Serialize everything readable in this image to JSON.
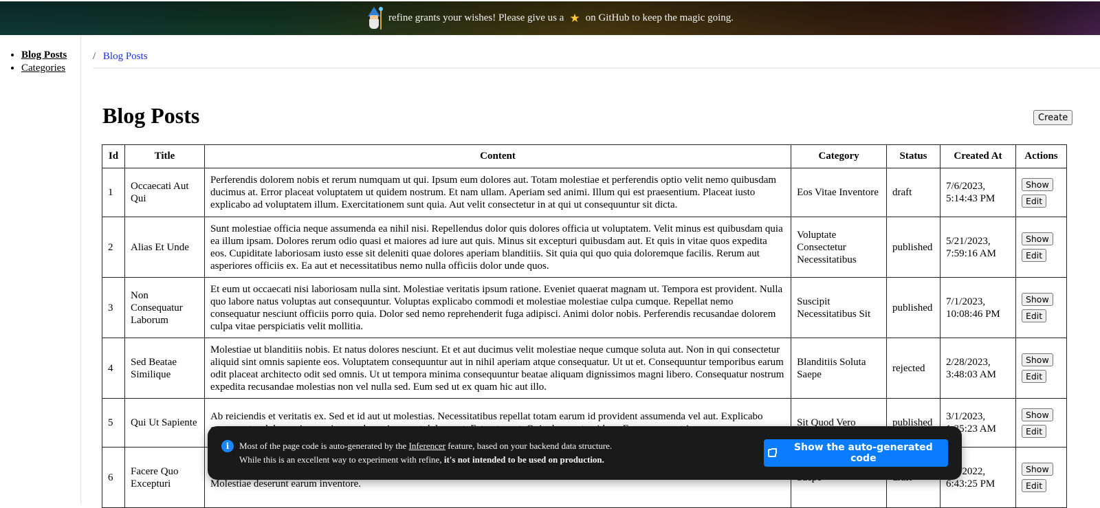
{
  "banner": {
    "text_before": "refine grants your wishes! Please give us a",
    "star": "★",
    "text_after": "on GitHub to keep the magic going."
  },
  "sidebar": {
    "items": [
      {
        "label": "Blog Posts",
        "active": true
      },
      {
        "label": "Categories",
        "active": false
      }
    ]
  },
  "breadcrumb": {
    "separator": "/",
    "items": [
      "Blog Posts"
    ]
  },
  "page": {
    "title": "Blog Posts",
    "create_label": "Create"
  },
  "table": {
    "headers": [
      "Id",
      "Title",
      "Content",
      "Category",
      "Status",
      "Created At",
      "Actions"
    ],
    "rows": [
      {
        "id": "1",
        "title": "Occaecati Aut Qui",
        "content": "Perferendis dolorem nobis et rerum numquam ut qui. Ipsum eum dolores aut. Totam molestiae et perferendis optio velit nemo quibusdam ducimus at. Error placeat voluptatem ut quidem nostrum. Et nam ullam. Aperiam sed animi. Illum qui est praesentium. Placeat iusto explicabo ad voluptatem illum. Exercitationem sunt quia. Aut velit consectetur in at qui ut consequuntur sit dicta.",
        "category": "Eos Vitae Inventore",
        "status": "draft",
        "created_at": "7/6/2023, 5:14:43 PM",
        "show_label": "Show",
        "edit_label": "Edit"
      },
      {
        "id": "2",
        "title": "Alias Et Unde",
        "content": "Sunt molestiae officia neque assumenda ea nihil nisi. Repellendus dolor quis dolores officia ut voluptatem. Velit minus est quibusdam quia ea illum ipsam. Dolores rerum odio quasi et maiores ad iure aut quis. Minus sit excepturi quibusdam aut. Et quis in vitae quos expedita eos. Cupiditate laboriosam iusto esse sit deleniti quae dolores aperiam blanditiis. Sit quia qui quo quia doloremque facilis. Rerum aut asperiores officiis ex. Ea aut et necessitatibus nemo nulla officiis dolor unde quos.",
        "category": "Voluptate Consectetur Necessitatibus",
        "status": "published",
        "created_at": "5/21/2023, 7:59:16 AM",
        "show_label": "Show",
        "edit_label": "Edit"
      },
      {
        "id": "3",
        "title": "Non Consequatur Laborum",
        "content": "Et eum ut occaecati nisi laboriosam nulla sint. Molestiae veritatis ipsum ratione. Eveniet quaerat magnam ut. Tempora est provident. Nulla quo labore natus voluptas aut consequuntur. Voluptas explicabo commodi et molestiae molestiae culpa cumque. Repellat nemo consequatur nesciunt officiis porro quia. Dolor sed nemo reprehenderit fuga adipisci. Animi dolor nobis. Perferendis recusandae dolorem culpa vitae perspiciatis velit mollitia.",
        "category": "Suscipit Necessitatibus Sit",
        "status": "published",
        "created_at": "7/1/2023, 10:08:46 PM",
        "show_label": "Show",
        "edit_label": "Edit"
      },
      {
        "id": "4",
        "title": "Sed Beatae Similique",
        "content": "Molestiae ut blanditiis nobis. Et natus dolores nesciunt. Et et aut ducimus velit molestiae neque cumque soluta aut. Non in qui consectetur aliquid sint omnis sapiente eos. Voluptatem consequuntur aut in nihil aperiam atque consequatur. Ut ut et. Consequuntur temporibus earum odit placeat architecto odit sed omnis. Ut ut tempora minima consequuntur beatae aliquam dignissimos magni libero. Consequatur nostrum expedita recusandae molestias non vel nulla sed. Eum sed ut ex quam hic aut illo.",
        "category": "Blanditiis Soluta Saepe",
        "status": "rejected",
        "created_at": "2/28/2023, 3:48:03 AM",
        "show_label": "Show",
        "edit_label": "Edit"
      },
      {
        "id": "5",
        "title": "Qui Ut Sapiente",
        "content": "Ab reiciendis et veritatis ex. Sed et id aut ut molestias. Necessitatibus repellat totam earum id provident assumenda vel aut. Explicabo consequatur dolorem iure maiores vel possimus aut dolores et. Est autem et. Quia deserunt quidem. Earum non aut ipsum.",
        "category": "Sit Quod Vero",
        "status": "published",
        "created_at": "3/1/2023, 1:35:23 AM",
        "show_label": "Show",
        "edit_label": "Edit"
      },
      {
        "id": "6",
        "title": "Facere Quo Excepturi",
        "content": "nisi est molestiae praesentium fugiat eum. Repellat nihil nihil temporibus necessitatibus architecto explicabo reiciendis. Voluptas sit ut. Molestiae deserunt earum inventore.",
        "category": "Saepe",
        "status": "draft",
        "created_at": "7/7/2022, 6:43:25 PM",
        "show_label": "Show",
        "edit_label": "Edit"
      }
    ]
  },
  "toast": {
    "line1_before": "Most of the page code is auto-generated by the",
    "line1_link": "Inferencer",
    "line1_after": "feature, based on your backend data structure.",
    "line2_before": "While this is an excellent way to experiment with refine,",
    "line2_bold": "it's not intended to be used on production.",
    "button_label": "Show the auto-generated code",
    "button_color": "#0a7cff"
  }
}
